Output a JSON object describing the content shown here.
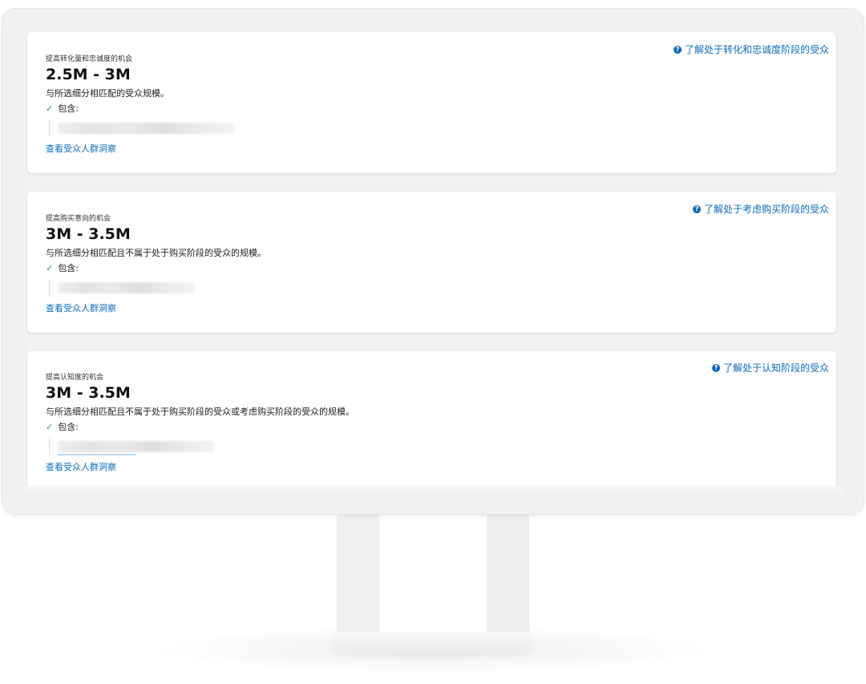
{
  "cards": [
    {
      "subtitle": "提高转化量和忠诚度的机会",
      "range": "2.5M - 3M",
      "description": "与所选细分相匹配的受众规模。",
      "includes_label": "包含:",
      "insight_link": "查看受众人群洞察",
      "learn_link": "了解处于转化和忠诚度阶段的受众"
    },
    {
      "subtitle": "提高购买意向的机会",
      "range": "3M - 3.5M",
      "description": "与所选细分相匹配且不属于处于购买阶段的受众的规模。",
      "includes_label": "包含:",
      "insight_link": "查看受众人群洞察",
      "learn_link": "了解处于考虑购买阶段的受众"
    },
    {
      "subtitle": "提高认知度的机会",
      "range": "3M - 3.5M",
      "description": "与所选细分相匹配且不属于处于购买阶段的受众或考虑购买阶段的受众的规模。",
      "includes_label": "包含:",
      "insight_link": "查看受众人群洞察",
      "learn_link": "了解处于认知阶段的受众"
    }
  ],
  "icons": {
    "help": "help-circle-icon",
    "check": "checkmark-icon"
  },
  "colors": {
    "link": "#0f6cbd",
    "check": "#2e9e44",
    "card_bg": "#ffffff",
    "screen_bg": "#f2f2f2"
  }
}
